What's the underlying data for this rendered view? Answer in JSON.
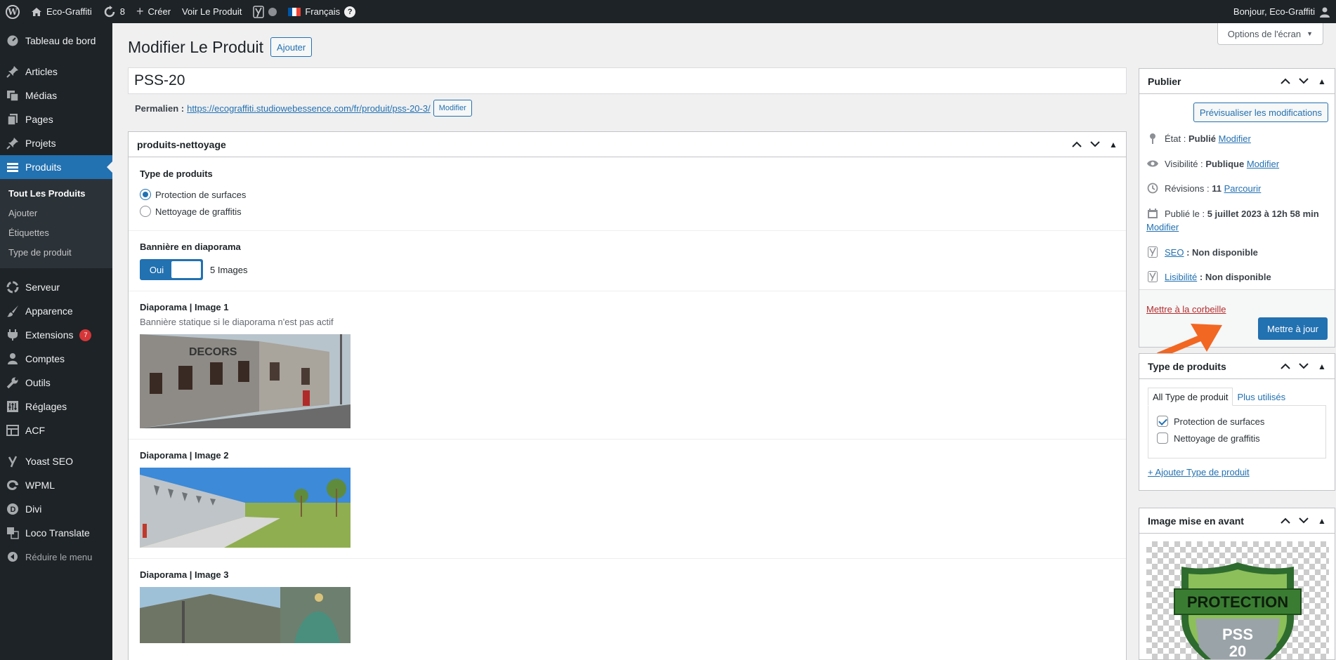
{
  "adminbar": {
    "site_name": "Eco-Graffiti",
    "updates_count": "8",
    "create_label": "Créer",
    "view_product": "Voir Le Produit",
    "language": "Français",
    "greeting": "Bonjour, Eco-Graffiti"
  },
  "sidebar": {
    "dashboard": "Tableau de bord",
    "articles": "Articles",
    "medias": "Médias",
    "pages": "Pages",
    "projets": "Projets",
    "produits": "Produits",
    "submenu": [
      "Tout Les Produits",
      "Ajouter",
      "Étiquettes",
      "Type de produit"
    ],
    "serveur": "Serveur",
    "apparence": "Apparence",
    "extensions": "Extensions",
    "extensions_badge": "7",
    "comptes": "Comptes",
    "outils": "Outils",
    "reglages": "Réglages",
    "acf": "ACF",
    "yoast": "Yoast SEO",
    "wpml": "WPML",
    "divi": "Divi",
    "loco": "Loco Translate",
    "collapse": "Réduire le menu"
  },
  "screen_options": "Options de l'écran",
  "page": {
    "title": "Modifier Le Produit",
    "add_button": "Ajouter",
    "post_title": "PSS-20",
    "permalink_label": "Permalien :",
    "permalink_url": "https://ecograffiti.studiowebessence.com/fr/produit/pss-20-3/",
    "permalink_edit": "Modifier"
  },
  "acf": {
    "box_title": "produits-nettoyage",
    "type_label": "Type de produits",
    "type_options": [
      "Protection de surfaces",
      "Nettoyage de graffitis"
    ],
    "type_selected": 0,
    "banner_label": "Bannière en diaporama",
    "toggle_on": "Oui",
    "images_count": "5 Images",
    "image1_label": "Diaporama | Image 1",
    "image1_desc": "Bannière statique si le diaporama n'est pas actif",
    "image2_label": "Diaporama | Image 2",
    "image3_label": "Diaporama | Image 3"
  },
  "publish": {
    "title": "Publier",
    "preview": "Prévisualiser les modifications",
    "status_label": "État :",
    "status_value": "Publié",
    "modify": "Modifier",
    "visibility_label": "Visibilité :",
    "visibility_value": "Publique",
    "revisions_label": "Révisions :",
    "revisions_value": "11",
    "browse": "Parcourir",
    "published_label": "Publié le :",
    "published_value": "5 juillet 2023 à 12h 58 min",
    "seo_link": "SEO",
    "seo_value": ": Non disponible",
    "readability_link": "Lisibilité",
    "readability_value": ": Non disponible",
    "trash": "Mettre à la corbeille",
    "update": "Mettre à jour"
  },
  "product_type": {
    "title": "Type de produits",
    "tab_all": "All Type de produit",
    "tab_popular": "Plus utilisés",
    "items": [
      "Protection de surfaces",
      "Nettoyage de graffitis"
    ],
    "checked": [
      true,
      false
    ],
    "add_link": "+ Ajouter Type de produit"
  },
  "featured": {
    "title": "Image mise en avant",
    "badge_text": "PROTECTION",
    "badge_sub": "PSS",
    "badge_num": "20"
  },
  "colors": {
    "accent": "#2271b1",
    "arrow": "#f26722",
    "danger": "#d63638"
  }
}
